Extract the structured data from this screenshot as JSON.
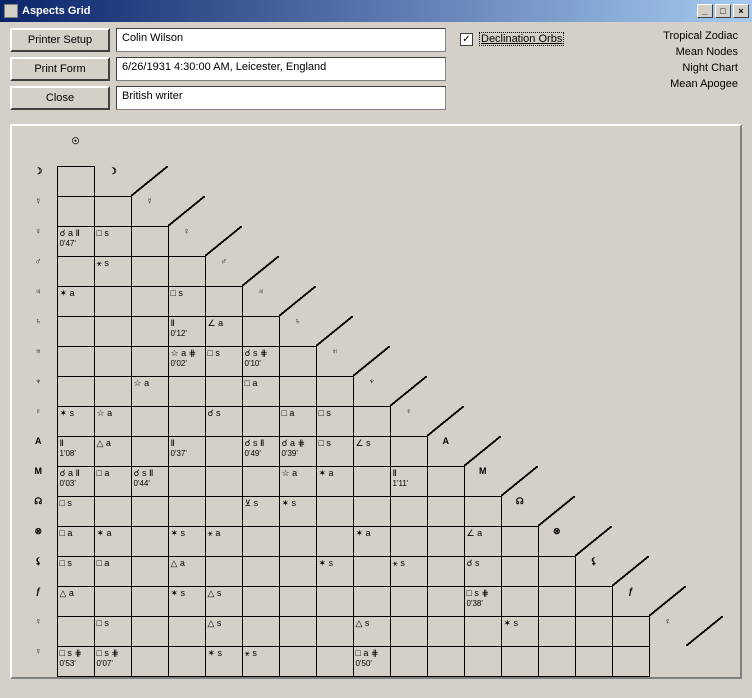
{
  "window": {
    "title": "Aspects Grid"
  },
  "buttons": {
    "printer_setup": "Printer Setup",
    "print_form": "Print Form",
    "close": "Close"
  },
  "fields": {
    "name": "Colin Wilson",
    "datetime": "6/26/1931 4:30:00 AM, Leicester, England",
    "desc": "British writer"
  },
  "checkbox": {
    "label": "Declination Orbs",
    "checked_glyph": "✓"
  },
  "info": {
    "l1": "Tropical Zodiac",
    "l2": "Mean Nodes",
    "l3": "Night Chart",
    "l4": "Mean Apogee"
  },
  "planets": [
    "☉",
    "☽",
    "☿",
    "♀",
    "♂",
    "♃",
    "♄",
    "♅",
    "♆",
    "♇",
    "A",
    "M",
    "☊",
    "⊗",
    "⚸",
    "ƒ",
    "♀"
  ],
  "grid": {
    "r2": {
      "c0": {
        "a": "☌ a Ⅱ",
        "o": "0'47'"
      },
      "c1": {
        "a": "□ s"
      }
    },
    "r3": {
      "c1": {
        "a": "⚹ s"
      }
    },
    "r4": {
      "c0": {
        "a": "✶ a"
      },
      "c3": {
        "a": "□ s"
      }
    },
    "r5": {
      "c3": {
        "a": "Ⅱ",
        "o": "0'12'"
      },
      "c4": {
        "a": "∠ a"
      }
    },
    "r6": {
      "c3": {
        "a": "☆ a ⋕",
        "o": "0'02'"
      },
      "c4": {
        "a": "□ s"
      },
      "c5": {
        "a": "☌ s ⋕",
        "o": "0'10'"
      }
    },
    "r7": {
      "c2": {
        "a": "☆ a"
      },
      "c5": {
        "a": "□ a"
      }
    },
    "r8": {
      "c0": {
        "a": "✶ s"
      },
      "c1": {
        "a": "☆ a"
      },
      "c4": {
        "a": "☌ s"
      },
      "c6": {
        "a": "□ a"
      },
      "c7": {
        "a": "□ s"
      }
    },
    "r9": {
      "c0": {
        "a": "Ⅱ",
        "o": "1'08'"
      },
      "c1": {
        "a": "△ a"
      },
      "c3": {
        "a": "Ⅱ",
        "o": "0'37'"
      },
      "c5": {
        "a": "☌ s Ⅱ",
        "o": "0'49'"
      },
      "c6": {
        "a": "☌ a ⋕",
        "o": "0'39'"
      },
      "c7": {
        "a": "□ s"
      },
      "c8": {
        "a": "∠ s"
      }
    },
    "r10": {
      "c0": {
        "a": "☌ a Ⅱ",
        "o": "0'03'"
      },
      "c1": {
        "a": "□ a"
      },
      "c2": {
        "a": "☌ s Ⅱ",
        "o": "0'44'"
      },
      "c6": {
        "a": "☆ a"
      },
      "c7": {
        "a": "✶ a"
      },
      "c9": {
        "a": "Ⅱ",
        "o": "1'11'"
      }
    },
    "r11": {
      "c0": {
        "a": "□ s"
      },
      "c5": {
        "a": "⊻ s"
      },
      "c6": {
        "a": "✶ s"
      }
    },
    "r12": {
      "c0": {
        "a": "□ a"
      },
      "c1": {
        "a": "✶ a"
      },
      "c3": {
        "a": "✶ s"
      },
      "c4": {
        "a": "⚹ a"
      },
      "c8": {
        "a": "✶ a"
      },
      "c11": {
        "a": "∠ a"
      }
    },
    "r13": {
      "c0": {
        "a": "□ s"
      },
      "c1": {
        "a": "□ a"
      },
      "c3": {
        "a": "△ a"
      },
      "c7": {
        "a": "✶ s"
      },
      "c9": {
        "a": "⚹ s"
      },
      "c11": {
        "a": "☌ s"
      }
    },
    "r14": {
      "c0": {
        "a": "△ a"
      },
      "c3": {
        "a": "✶ s"
      },
      "c4": {
        "a": "△ s"
      },
      "c11": {
        "a": "□ s ⋕",
        "o": "0'38'"
      }
    },
    "r15": {
      "c1": {
        "a": "□ s"
      },
      "c4": {
        "a": "△ s"
      },
      "c8": {
        "a": "△ s"
      },
      "c12": {
        "a": "✶ s"
      }
    },
    "r16": {
      "c0": {
        "a": "□ s ⋕",
        "o": "0'53'"
      },
      "c1": {
        "a": "□ s ⋕",
        "o": "0'07'"
      },
      "c4": {
        "a": "✶ s"
      },
      "c5": {
        "a": "⚹ s"
      },
      "c8": {
        "a": "□ a ⋕",
        "o": "0'50'"
      }
    }
  }
}
